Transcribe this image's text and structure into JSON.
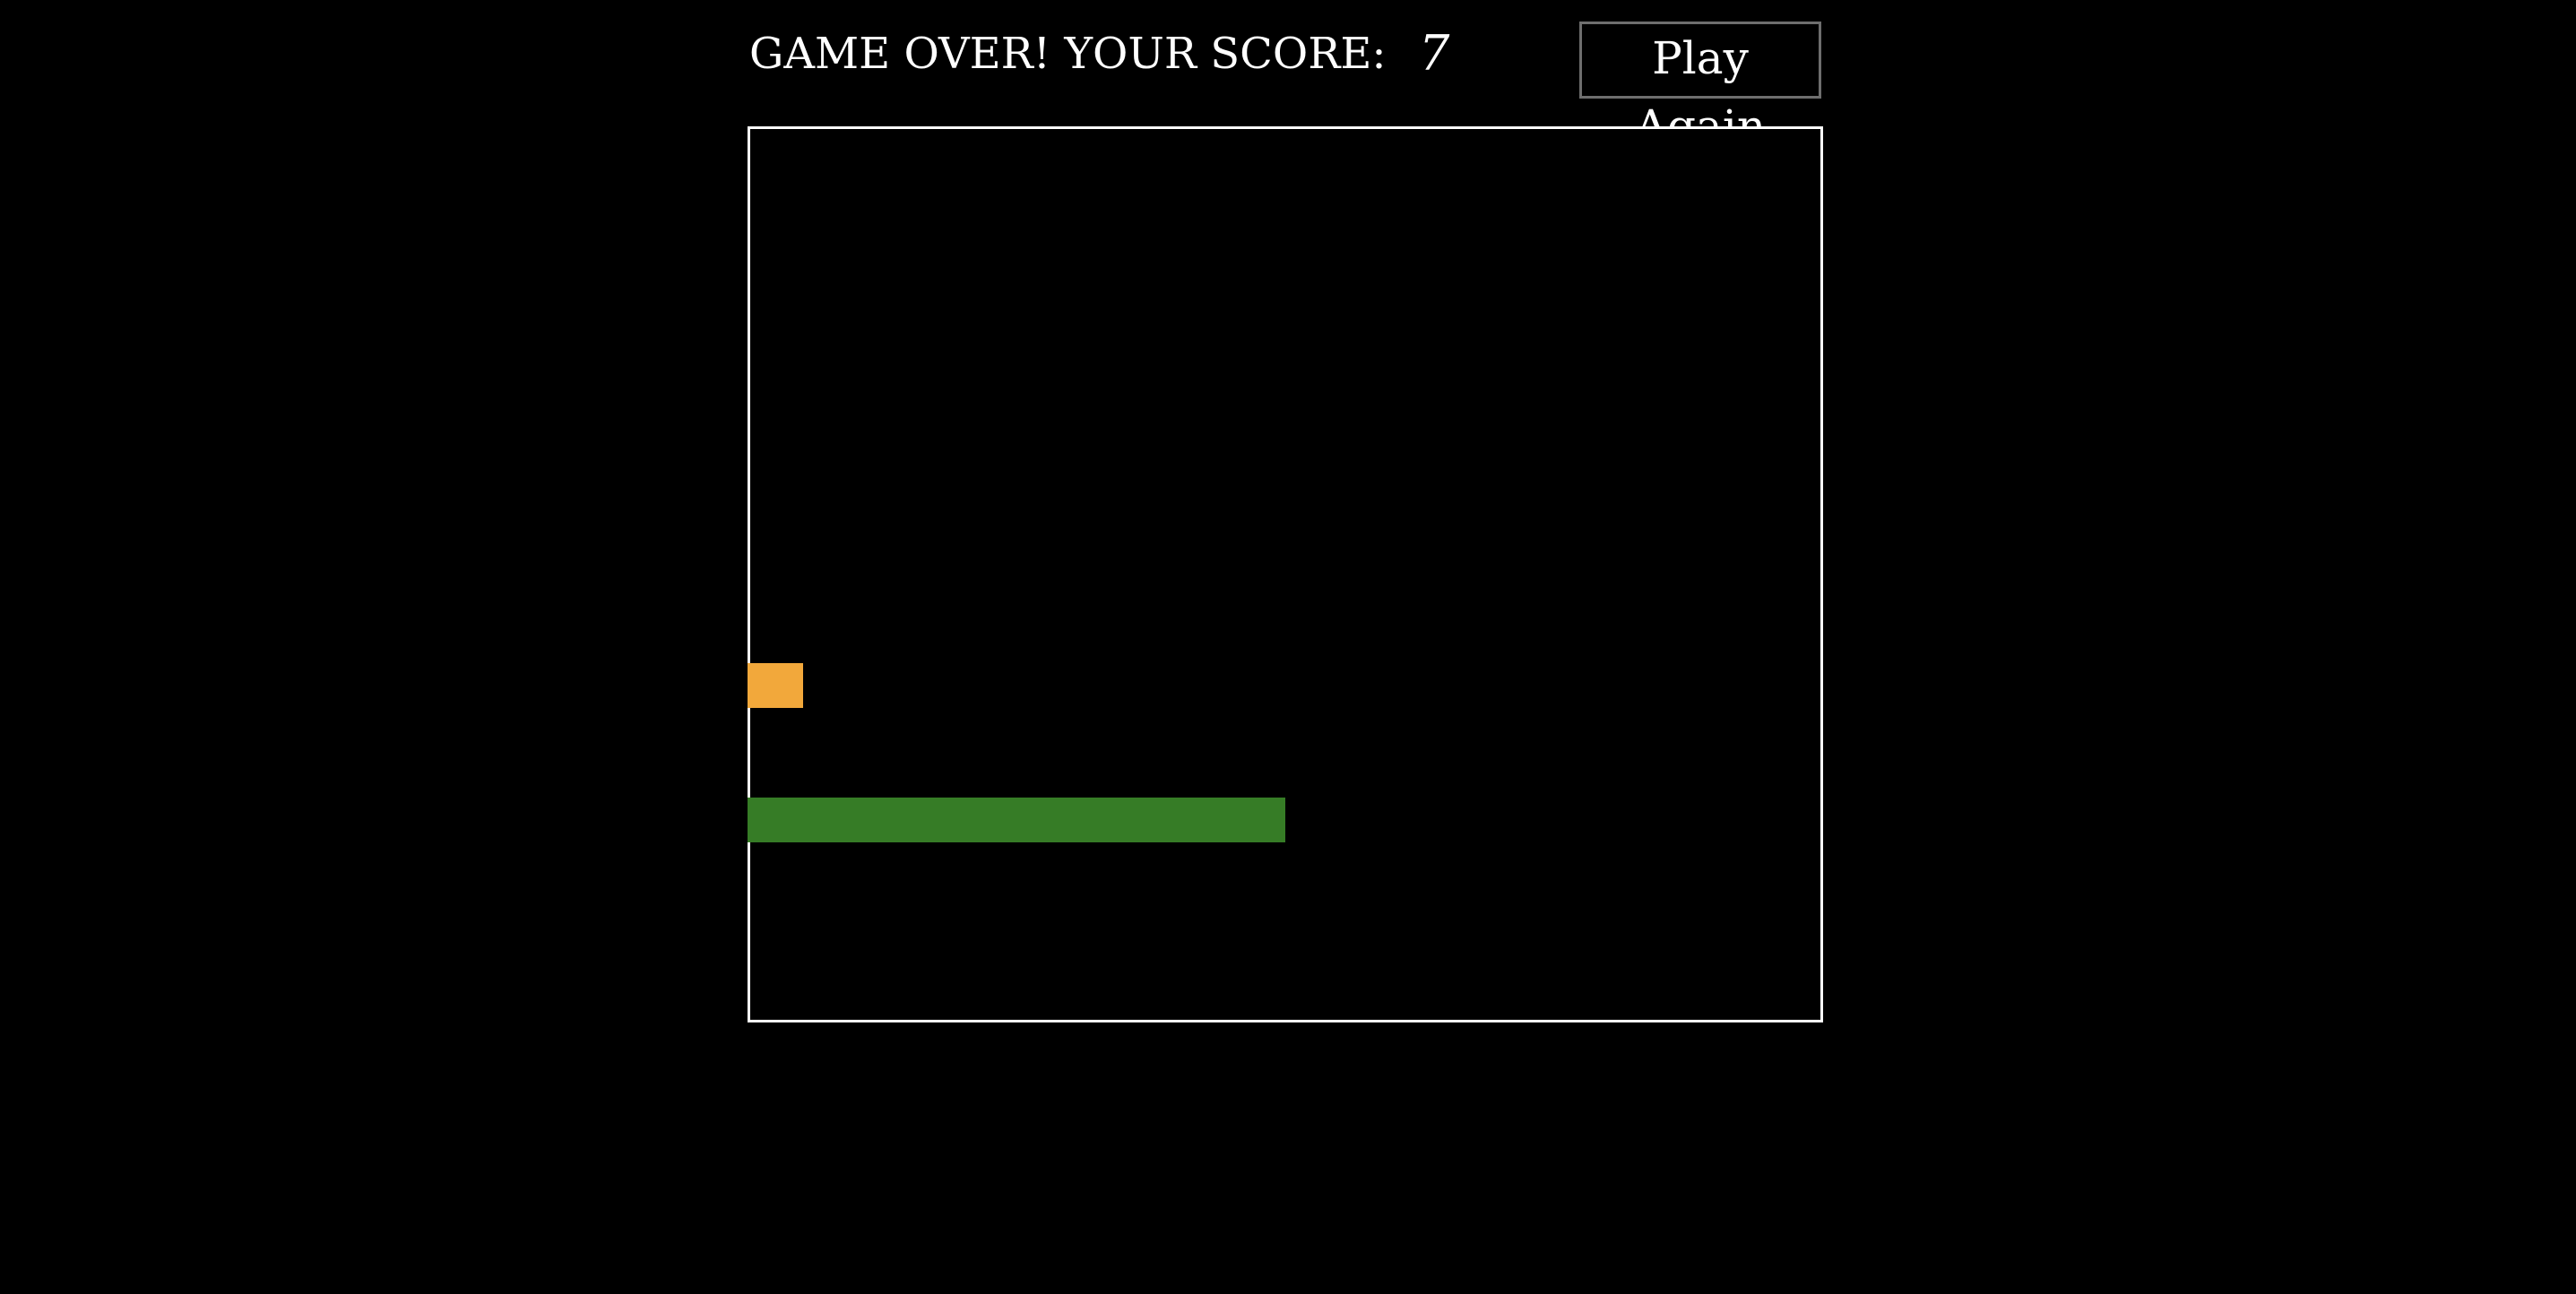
{
  "header": {
    "score_label": "GAME OVER! YOUR SCORE:",
    "score_value": "7",
    "play_again_label": "Play Again"
  },
  "colors": {
    "background": "#000000",
    "board_border": "#ffffff",
    "text": "#ffffff",
    "food": "#f2a83b",
    "snake": "#367c26",
    "button_border": "#6e6e6e"
  },
  "game": {
    "state": "game-over"
  }
}
